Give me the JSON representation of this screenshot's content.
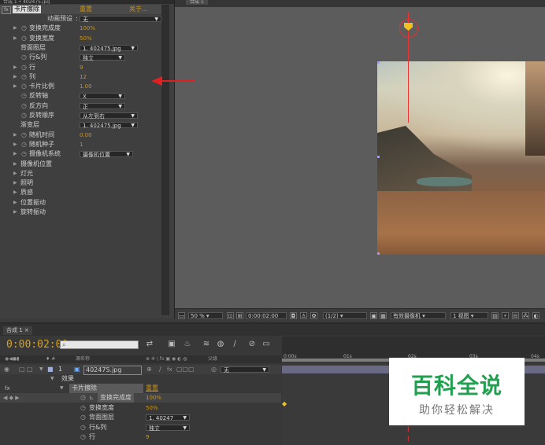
{
  "effect_controls": {
    "title": "合成 1 • 402475.jpg",
    "effect_name": "卡片擦除",
    "reset": "重置",
    "about": "关于...",
    "rows": [
      {
        "label": "动画预设",
        "value": "无",
        "kind": "dropdown"
      },
      {
        "label": "变换完成度",
        "value": "100%",
        "kind": "value"
      },
      {
        "label": "变换宽度",
        "value": "50%",
        "kind": "value"
      },
      {
        "label": "背面图层",
        "value": "1. 402475.jpg",
        "kind": "dropdown"
      },
      {
        "label": "行&列",
        "value": "独立",
        "kind": "dropdown"
      },
      {
        "label": "行",
        "value": "9",
        "kind": "value"
      },
      {
        "label": "列",
        "value": "12",
        "kind": "value"
      },
      {
        "label": "卡片比例",
        "value": "1.00",
        "kind": "value"
      },
      {
        "label": "反转轴",
        "value": "X",
        "kind": "dropdown"
      },
      {
        "label": "反方向",
        "value": "正",
        "kind": "dropdown"
      },
      {
        "label": "反转顺序",
        "value": "从左到右",
        "kind": "dropdown"
      },
      {
        "label": "渐变层",
        "value": "1. 402475.jpg",
        "kind": "dropdown"
      },
      {
        "label": "随机时间",
        "value": "0.00",
        "kind": "value"
      },
      {
        "label": "随机种子",
        "value": "1",
        "kind": "value"
      },
      {
        "label": "摄像机系统",
        "value": "摄像机位置",
        "kind": "dropdown"
      },
      {
        "label": "摄像机位置",
        "value": "",
        "kind": "group"
      },
      {
        "label": "灯光",
        "value": "",
        "kind": "group"
      },
      {
        "label": "照明",
        "value": "",
        "kind": "group"
      },
      {
        "label": "质感",
        "value": "",
        "kind": "group"
      },
      {
        "label": "位置振动",
        "value": "",
        "kind": "group"
      },
      {
        "label": "旋转振动",
        "value": "",
        "kind": "group"
      }
    ]
  },
  "composition": {
    "tab": "合成 1",
    "zoom": "50 %",
    "timecode": "0:00:02:00",
    "resolution": "(1/2)",
    "camera": "有效摄像机",
    "views": "1 视图"
  },
  "timeline": {
    "tab": "合成 1",
    "timecode": "0:00:02:00",
    "ruler_ticks": [
      "0:00s",
      "01s",
      "02s",
      "03s",
      "04s"
    ],
    "col_source": "源名称",
    "col_parent": "父级",
    "layer_number": "1",
    "layer_name": "402475.jpg",
    "parent_value": "无",
    "effects_group": "效果",
    "effect_name": "卡片擦除",
    "reset": "重置",
    "rows": [
      {
        "label": "变换完成度",
        "value": "100%",
        "kind": "value"
      },
      {
        "label": "变换宽度",
        "value": "50%",
        "kind": "value"
      },
      {
        "label": "背面图层",
        "value": "1. 40247",
        "kind": "dropdown"
      },
      {
        "label": "行&列",
        "value": "独立",
        "kind": "dropdown"
      },
      {
        "label": "行",
        "value": "9",
        "kind": "value"
      }
    ]
  },
  "watermark": {
    "title": "百科全说",
    "subtitle": "助你轻松解决"
  }
}
